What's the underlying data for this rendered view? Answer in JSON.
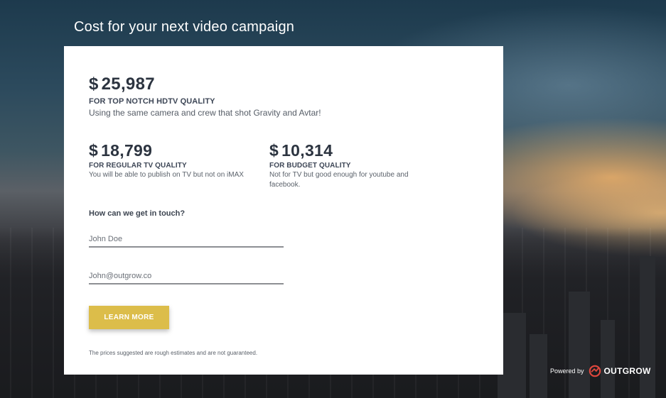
{
  "header": {
    "title": "Cost for your next video campaign"
  },
  "top_tier": {
    "currency": "$",
    "price": "25,987",
    "quality": "FOR TOP NOTCH HDTV QUALITY",
    "description": "Using the same camera and crew that shot Gravity and Avtar!"
  },
  "tiers": [
    {
      "currency": "$",
      "price": "18,799",
      "quality": "FOR REGULAR TV QUALITY",
      "description": "You will be able to publish on TV but not on iMAX"
    },
    {
      "currency": "$",
      "price": "10,314",
      "quality": "FOR BUDGET QUALITY",
      "description": "Not for TV but good enough for youtube and facebook."
    }
  ],
  "contact": {
    "label": "How can we get in touch?",
    "name_placeholder": "John Doe",
    "email_placeholder": "John@outgrow.co",
    "button_label": "LEARN MORE"
  },
  "disclaimer": "The prices suggested are rough estimates and are not guaranteed.",
  "footer": {
    "powered_by": "Powered by",
    "brand": "OUTGROW",
    "logo_icon": "outgrow-logo-icon"
  },
  "colors": {
    "button": "#dcbd4a",
    "text_dark": "#2c3440",
    "card": "#ffffff"
  }
}
